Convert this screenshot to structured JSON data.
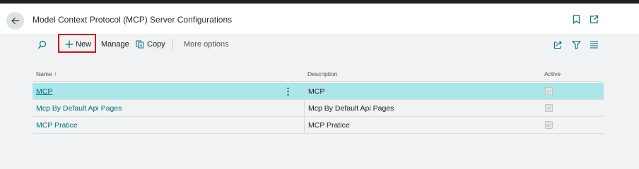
{
  "header": {
    "title": "Model Context Protocol (MCP) Server Configurations"
  },
  "actions": {
    "new_label": "New",
    "manage_label": "Manage",
    "copy_label": "Copy",
    "more_label": "More options"
  },
  "table": {
    "columns": {
      "name": "Name",
      "sort_indicator": "↑",
      "description": "Description",
      "active": "Active"
    },
    "rows": [
      {
        "name": "MCP",
        "description": "MCP",
        "active": true,
        "selected": true
      },
      {
        "name": "Mcp By Default Api Pages",
        "description": "Mcp By Default Api Pages",
        "active": true,
        "selected": false
      },
      {
        "name": "MCP Pratice",
        "description": "MCP Pratice",
        "active": true,
        "selected": false
      }
    ]
  },
  "icons": {
    "back": "arrow-left-icon",
    "bookmark": "bookmark-icon",
    "open_new": "open-in-new-window-icon",
    "search": "search-icon",
    "add": "plus-icon",
    "copy": "copy-icon",
    "share": "share-icon",
    "filter": "filter-icon",
    "list": "list-view-icon",
    "row_menu": "more-vertical-icon"
  },
  "colors": {
    "accent": "#00707a",
    "selected_row": "#aae6ea",
    "highlight_box": "#d0141b"
  }
}
